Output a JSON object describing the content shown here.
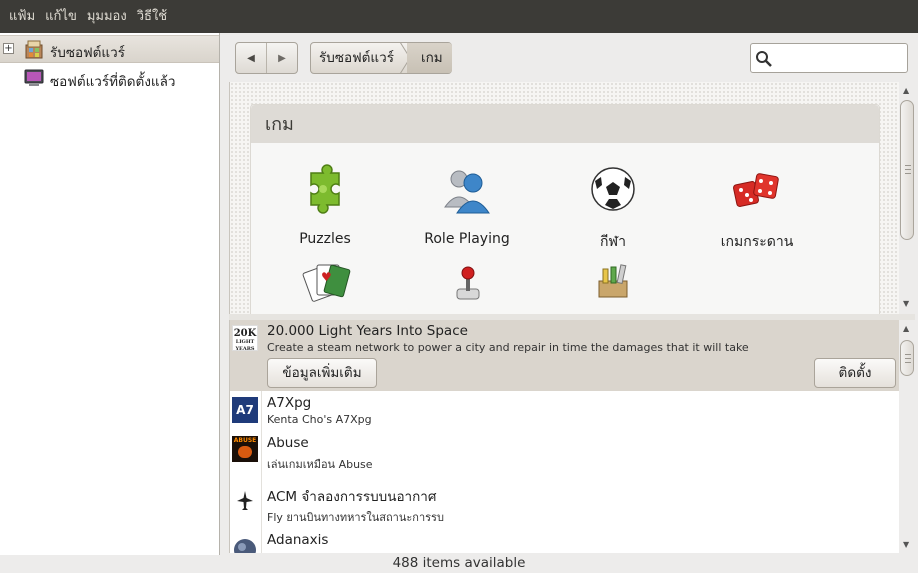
{
  "menubar": {
    "items": [
      "แฟ้ม",
      "แก้ไข",
      "มุมมอง",
      "วิธีใช้"
    ]
  },
  "sidebar": {
    "items": [
      {
        "label": "รับซอฟต์แวร์",
        "icon": "software-center-icon",
        "expander": "+"
      },
      {
        "label": "ซอฟต์แวร์ที่ติดตั้งแล้ว",
        "icon": "monitor-icon"
      }
    ]
  },
  "toolbar": {
    "back": "◀",
    "forward": "▶",
    "breadcrumb": [
      "รับซอฟต์แวร์",
      "เกม"
    ],
    "search": {
      "value": "",
      "placeholder": ""
    }
  },
  "category": {
    "title": "เกม",
    "items": [
      {
        "label": "Puzzles",
        "icon": "puzzle-icon"
      },
      {
        "label": "Role Playing",
        "icon": "role-playing-icon"
      },
      {
        "label": "กีฬา",
        "icon": "soccer-ball-icon"
      },
      {
        "label": "เกมกระดาน",
        "icon": "dice-icon"
      },
      {
        "label": "",
        "icon": "playing-cards-icon"
      },
      {
        "label": "",
        "icon": "joystick-icon"
      },
      {
        "label": "",
        "icon": "toolbox-icon"
      }
    ]
  },
  "apps": {
    "selected": {
      "icon_text": [
        "20K",
        "LIGHT",
        "YEARS"
      ],
      "name": "20.000 Light Years Into Space",
      "summary": "Create a steam network to power a city and repair in time the damages that it will take",
      "more_info": "ข้อมูลเพิ่มเติม",
      "install": "ติดตั้ง"
    },
    "items": [
      {
        "name": "A7Xpg",
        "summary": "Kenta Cho's A7Xpg",
        "icon_text": "A7"
      },
      {
        "name": "Abuse",
        "summary": "เล่นเกมเหมือน Abuse",
        "icon_text": "ABUSE"
      },
      {
        "name": "ACM จำลองการรบบนอากาศ",
        "summary": "Fly ยานบินทางทหารในสถานะการรบ",
        "icon_text": ""
      },
      {
        "name": "Adanaxis",
        "summary": "",
        "icon_text": ""
      }
    ]
  },
  "status": {
    "text": "488 items available"
  },
  "colors": {
    "menubar": "#3c3b37",
    "selection": "#dad5cd",
    "background": "#edeceb"
  }
}
